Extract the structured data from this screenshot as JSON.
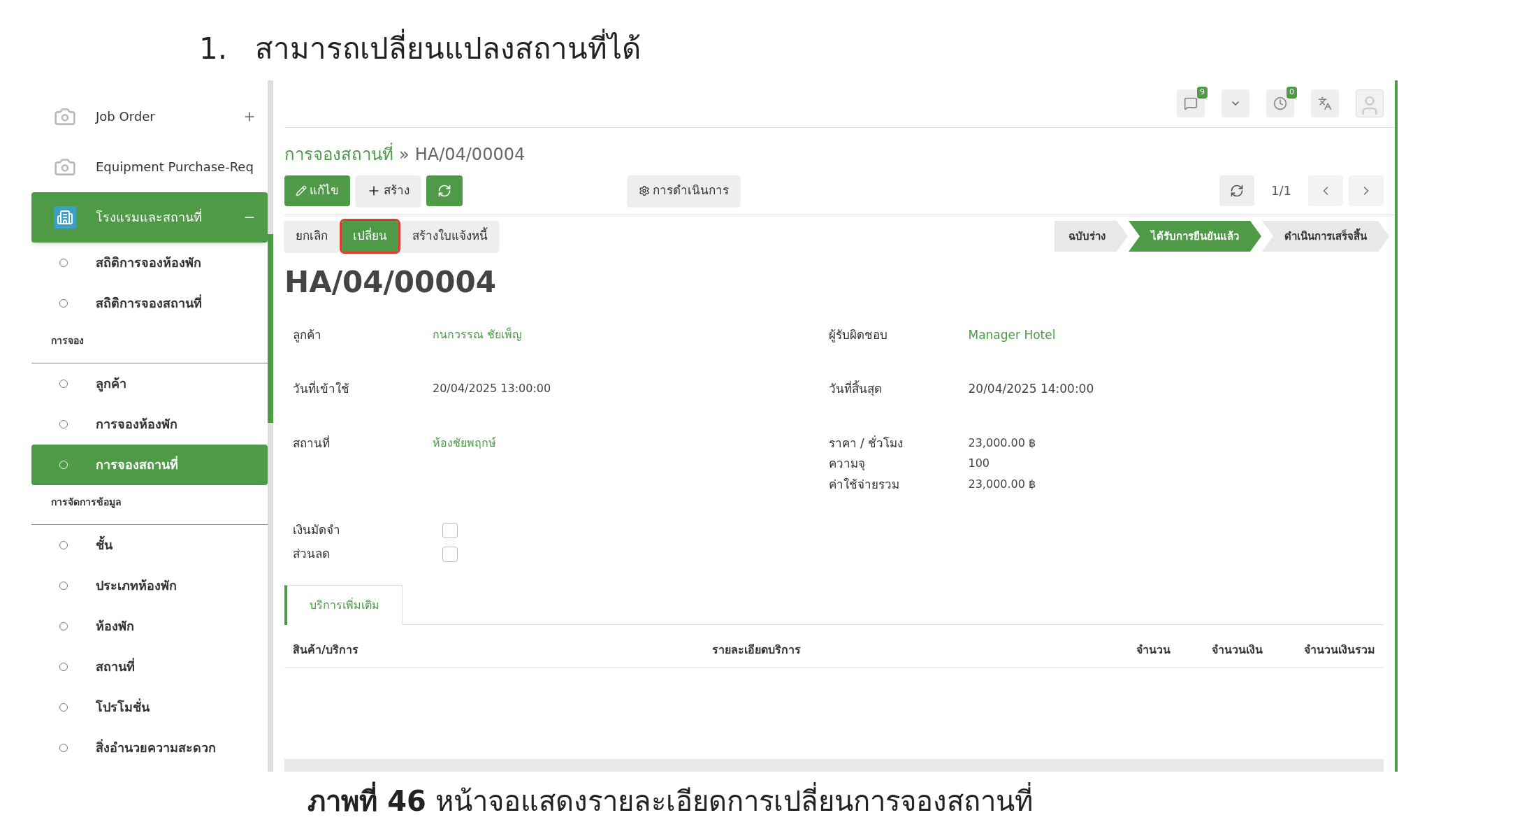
{
  "heading": {
    "number": "1.",
    "text": "สามารถเปลี่ยนแปลงสถานที่ได้"
  },
  "sidebar": {
    "items": [
      {
        "kind": "app",
        "label": "Job Order",
        "expanded": false,
        "selected": false
      },
      {
        "kind": "app",
        "label": "Equipment Purchase-Req",
        "selected": false
      },
      {
        "kind": "app",
        "label": "โรงแรมและสถานที่",
        "expanded": true,
        "selected": true
      },
      {
        "kind": "item",
        "label": "สถิติการจองห้องพัก",
        "selected": false
      },
      {
        "kind": "item",
        "label": "สถิติการจองสถานที่",
        "selected": false
      },
      {
        "kind": "section",
        "label": "การจอง"
      },
      {
        "kind": "item",
        "label": "ลูกค้า",
        "selected": false
      },
      {
        "kind": "item",
        "label": "การจองห้องพัก",
        "selected": false
      },
      {
        "kind": "item",
        "label": "การจองสถานที่",
        "selected": true
      },
      {
        "kind": "section",
        "label": "การจัดการข้อมูล"
      },
      {
        "kind": "item",
        "label": "ชั้น",
        "selected": false
      },
      {
        "kind": "item",
        "label": "ประเภทห้องพัก",
        "selected": false
      },
      {
        "kind": "item",
        "label": "ห้องพัก",
        "selected": false
      },
      {
        "kind": "item",
        "label": "สถานที่",
        "selected": false
      },
      {
        "kind": "item",
        "label": "โปรโมชั่น",
        "selected": false
      },
      {
        "kind": "item",
        "label": "สิ่งอำนวยความสะดวก",
        "selected": false
      }
    ]
  },
  "topbar": {
    "messages_badge": "9",
    "activities_badge": "0"
  },
  "breadcrumb": {
    "parent": "การจองสถานที่",
    "separator": "»",
    "current": "HA/04/00004"
  },
  "toolbar": {
    "edit": "แก้ไข",
    "create": "สร้าง",
    "action": "การดำเนินการ",
    "pager": "1/1"
  },
  "actions": [
    {
      "label": "ยกเลิก",
      "highlighted": false
    },
    {
      "label": "เปลี่ยน",
      "highlighted": true
    },
    {
      "label": "สร้างใบแจ้งหนี้",
      "highlighted": false
    }
  ],
  "status_steps": [
    {
      "label": "ฉบับร่าง",
      "selected": false
    },
    {
      "label": "ได้รับการยืนยันแล้ว",
      "selected": true
    },
    {
      "label": "ดำเนินการเสร็จสิ้น",
      "selected": false
    }
  ],
  "title": "HA/04/00004",
  "fields_left": [
    {
      "label": "ลูกค้า",
      "value": "กนกวรรณ ชัยเพ็ญ",
      "link": true
    },
    {
      "label": "วันที่เข้าใช้",
      "value": "20/04/2025 13:00:00",
      "link": false
    },
    {
      "label": "สถานที่",
      "value": "ห้องชัยพฤกษ์",
      "link": true
    }
  ],
  "fields_right": [
    {
      "label": "ผู้รับผิดชอบ",
      "value": "Manager Hotel",
      "link": true
    },
    {
      "label": "วันที่สิ้นสุด",
      "value": "20/04/2025 14:00:00",
      "link": false
    }
  ],
  "price_fields": [
    {
      "label": "ราคา / ชั่วโมง",
      "value": "23,000.00 ฿"
    },
    {
      "label": "ความจุ",
      "value": "100"
    },
    {
      "label": "ค่าใช้จ่ายรวม",
      "value": "23,000.00 ฿"
    }
  ],
  "checkboxes": [
    {
      "label": "เงินมัดจำ",
      "checked": false
    },
    {
      "label": "ส่วนลด",
      "checked": false
    }
  ],
  "tabs": [
    {
      "label": "บริการเพิ่มเติม",
      "selected": true
    }
  ],
  "table": {
    "columns": [
      "สินค้า/บริการ",
      "รายละเอียดบริการ",
      "จำนวน",
      "จำนวนเงิน",
      "จำนวนเงินรวม"
    ]
  },
  "caption": "**ภาพที่  46** หน้าจอแสดงรายละเอียดการเปลี่ยนการจองสถานที่"
}
